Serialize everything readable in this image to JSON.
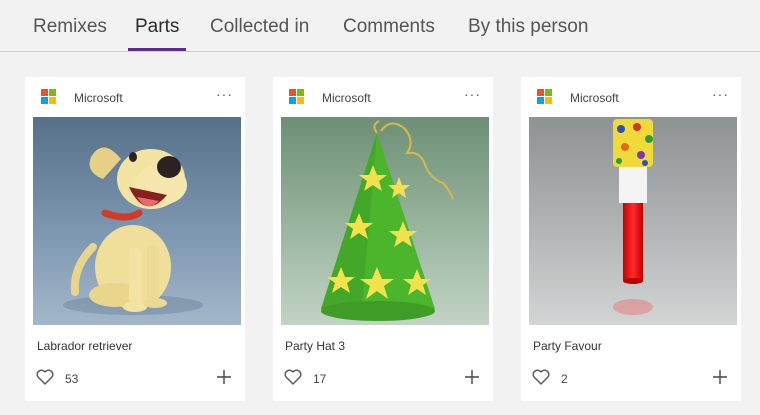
{
  "tabs": [
    {
      "label": "Remixes",
      "active": false
    },
    {
      "label": "Parts",
      "active": true
    },
    {
      "label": "Collected in",
      "active": false
    },
    {
      "label": "Comments",
      "active": false
    },
    {
      "label": "By this person",
      "active": false
    }
  ],
  "colors": {
    "accent": "#5c2d91",
    "background": "#f2f2f2",
    "card": "#ffffff"
  },
  "cards": [
    {
      "author": "Microsoft",
      "author_icon": "microsoft-logo-icon",
      "more": "···",
      "title": "Labrador retriever",
      "likes": "53",
      "like_icon": "heart-icon",
      "add_icon": "plus-icon"
    },
    {
      "author": "Microsoft",
      "author_icon": "microsoft-logo-icon",
      "more": "···",
      "title": "Party Hat 3",
      "likes": "17",
      "like_icon": "heart-icon",
      "add_icon": "plus-icon"
    },
    {
      "author": "Microsoft",
      "author_icon": "microsoft-logo-icon",
      "more": "···",
      "title": "Party Favour",
      "likes": "2",
      "like_icon": "heart-icon",
      "add_icon": "plus-icon"
    }
  ]
}
